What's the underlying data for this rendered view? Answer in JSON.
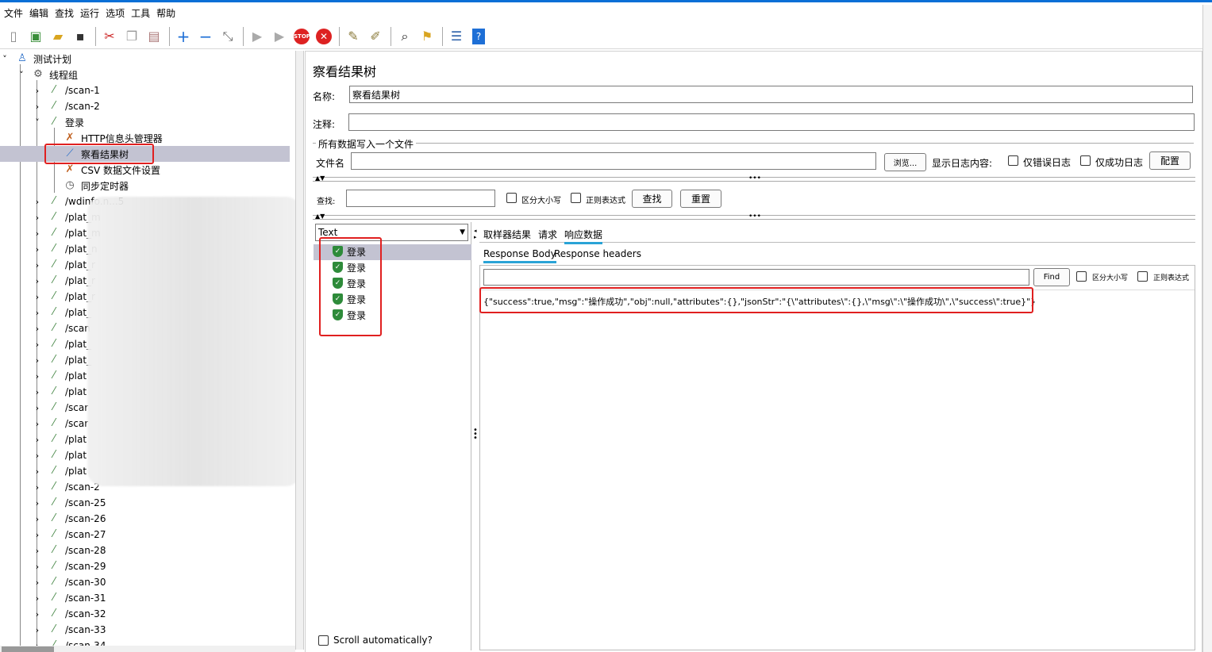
{
  "menu": [
    "文件",
    "编辑",
    "查找",
    "运行",
    "选项",
    "工具",
    "帮助"
  ],
  "toolbar_icons": [
    "new-icon",
    "templates-icon",
    "open-icon",
    "save-icon",
    "cut-icon",
    "copy-icon",
    "paste-icon",
    "expand-icon",
    "collapse-icon",
    "toggle-icon",
    "start-icon",
    "start-no-pause-icon",
    "stop-icon",
    "shutdown-icon",
    "clear-icon",
    "clear-all-icon",
    "search-icon",
    "reset-search-icon",
    "function-helper-icon",
    "help-icon"
  ],
  "tree": {
    "root": "测试计划",
    "thread_group": "线程组",
    "items": [
      "/scan-1",
      "/scan-2",
      "登录",
      "HTTP信息头管理器",
      "察看结果树",
      "CSV 数据文件设置",
      "同步定时器",
      "/wdinfo.n...5",
      "/plat_m",
      "/plat_m",
      "/plat_n",
      "/plat_r",
      "/plat_r",
      "/plat_r",
      "/plat_",
      "/scan",
      "/plat_",
      "/plat_",
      "/plat",
      "/plat",
      "/scar",
      "/scar",
      "/plat",
      "/plat",
      "/plat",
      "/scan-2",
      "/scan-25",
      "/scan-26",
      "/scan-27",
      "/scan-28",
      "/scan-29",
      "/scan-30",
      "/scan-31",
      "/scan-32",
      "/scan-33",
      "/scan-34"
    ]
  },
  "panel": {
    "title": "察看结果树",
    "name_label": "名称:",
    "name_value": "察看结果树",
    "comment_label": "注释:",
    "comment_value": "",
    "file_group_label": "所有数据写入一个文件",
    "filename_label": "文件名",
    "filename_value": "",
    "browse_label": "浏览...",
    "log_label": "显示日志内容:",
    "errors_only": "仅错误日志",
    "success_only": "仅成功日志",
    "config_label": "配置",
    "search_label": "查找:",
    "search_value": "",
    "case_sensitive": "区分大小写",
    "regex": "正则表达式",
    "find_button": "查找",
    "reset_button": "重置"
  },
  "results": {
    "renderer": "Text",
    "samples": [
      "登录",
      "登录",
      "登录",
      "登录",
      "登录"
    ],
    "scroll_auto": "Scroll automatically?"
  },
  "detail": {
    "tabs": [
      "取样器结果",
      "请求",
      "响应数据"
    ],
    "active_tab": "响应数据",
    "subtabs": [
      "Response Body",
      "Response headers"
    ],
    "active_subtab": "Response Body",
    "find_value": "",
    "find_button": "Find",
    "case_sensitive": "区分大小写",
    "regex": "正则表达式",
    "response_body": "{\"success\":true,\"msg\":\"操作成功\",\"obj\":null,\"attributes\":{},\"jsonStr\":\"{\\\"attributes\\\":{},\\\"msg\\\":\\\"操作成功\\\",\\\"success\\\":true}\"}"
  },
  "colors": {
    "selection": "#c3c3d2",
    "annotation": "#e02020",
    "active_tab_underline": "#2aa3d6",
    "title_bar": "#0a6fd6"
  }
}
